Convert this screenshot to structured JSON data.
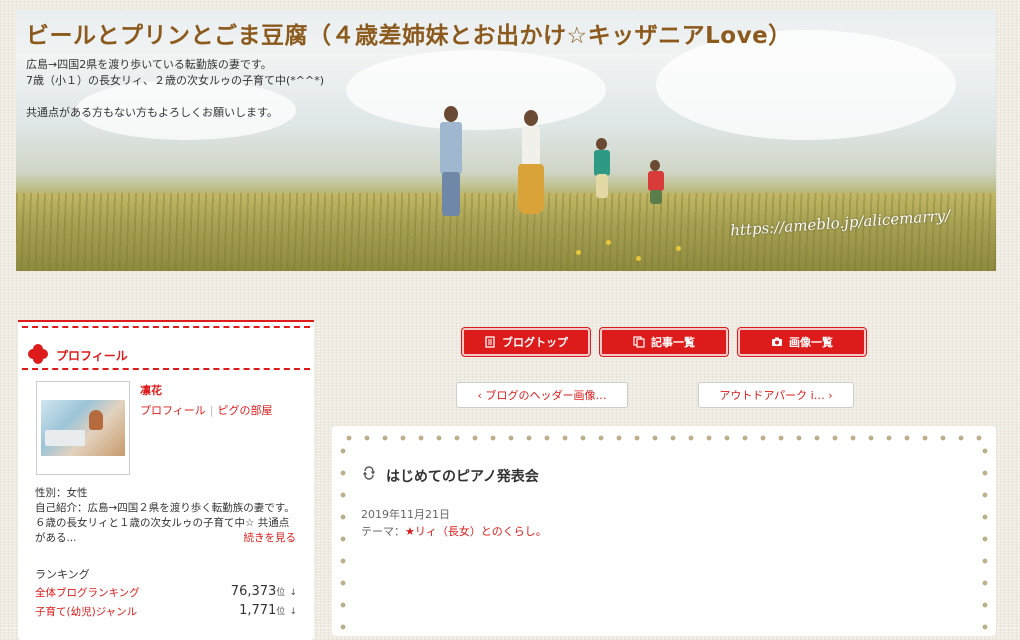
{
  "header": {
    "title": "ビールとプリンとごま豆腐（４歳差姉妹とお出かけ☆キッザニアLove）",
    "description": "広島→四国2県を渡り歩いている転勤族の妻です。\n7歳（小１）の長女リィ、２歳の次女ルゥの子育て中(*^^*)\n\n共通点がある方もない方もよろしくお願いします。",
    "watermark": "https://ameblo.jp/alicemarry/"
  },
  "profile": {
    "section_title": "プロフィール",
    "user_name": "凛花",
    "link_profile": "プロフィール",
    "link_pig_room": "ピグの部屋",
    "gender_line": "性別：女性",
    "intro": "自己紹介：広島→四国２県を渡り歩く転勤族の妻です。　６歳の長女リィと１歳の次女ルゥの子育て中☆ 共通点がある...",
    "more_label": "続きを見る",
    "ranking_title": "ランキング",
    "rankings": [
      {
        "label": "全体ブログランキング",
        "value": "76,373",
        "unit": "位",
        "arrow": "↓"
      },
      {
        "label": "子育て(幼児)ジャンル",
        "value": "1,771",
        "unit": "位",
        "arrow": "↓"
      }
    ]
  },
  "nav": {
    "blog_top": "ブログトップ",
    "article_list": "記事一覧",
    "image_list": "画像一覧"
  },
  "pager": {
    "prev": "‹ ブログのヘッダー画像…",
    "next": "アウトドアパーク i… ›"
  },
  "article": {
    "title": "はじめてのピアノ発表会",
    "date": "2019年11月21日",
    "theme_label": "テーマ：",
    "theme_value": "★リィ（長女）とのくらし。"
  },
  "colors": {
    "accent": "#dd1b1b",
    "title_brown": "#8b5a1c"
  },
  "icons": {
    "section": "clover-icon",
    "blog_top": "document-icon",
    "article_list": "copy-icon",
    "image_list": "camera-icon",
    "article": "reblog-icon"
  }
}
